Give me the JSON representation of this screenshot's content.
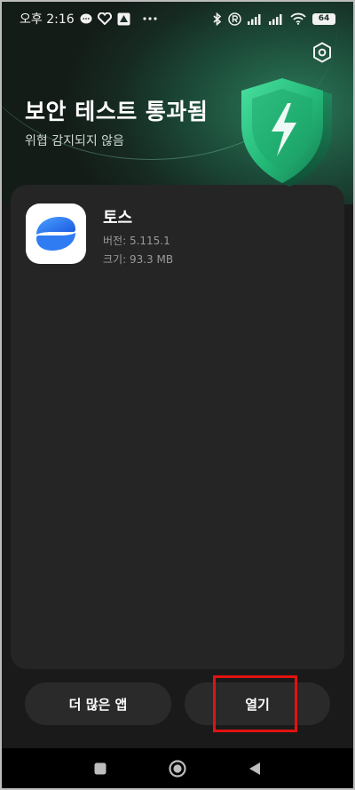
{
  "status_bar": {
    "time": "오후 2:16",
    "battery": "64",
    "icons": [
      "message-bubble-icon",
      "heart-icon",
      "app-badge-icon",
      "more-dots-icon",
      "bluetooth-icon",
      "r-circle-icon",
      "signal-icon",
      "signal-icon",
      "wifi-icon",
      "battery-icon"
    ]
  },
  "header": {
    "title": "보안 테스트 통과됨",
    "subtitle": "위협 감지되지 않음",
    "settings_icon": "settings-hex-icon",
    "accent_color": "#2ebf7e"
  },
  "app": {
    "name": "토스",
    "version": "버전: 5.115.1",
    "size": "크기: 93.3 MB",
    "icon": "toss-logo-icon",
    "icon_color": "#1a73e8"
  },
  "actions": {
    "more_apps": "더 많은 앱",
    "open": "열기",
    "highlight_color": "#e21212"
  },
  "nav": {
    "icons": [
      "recent-apps-icon",
      "home-icon",
      "back-icon"
    ]
  }
}
